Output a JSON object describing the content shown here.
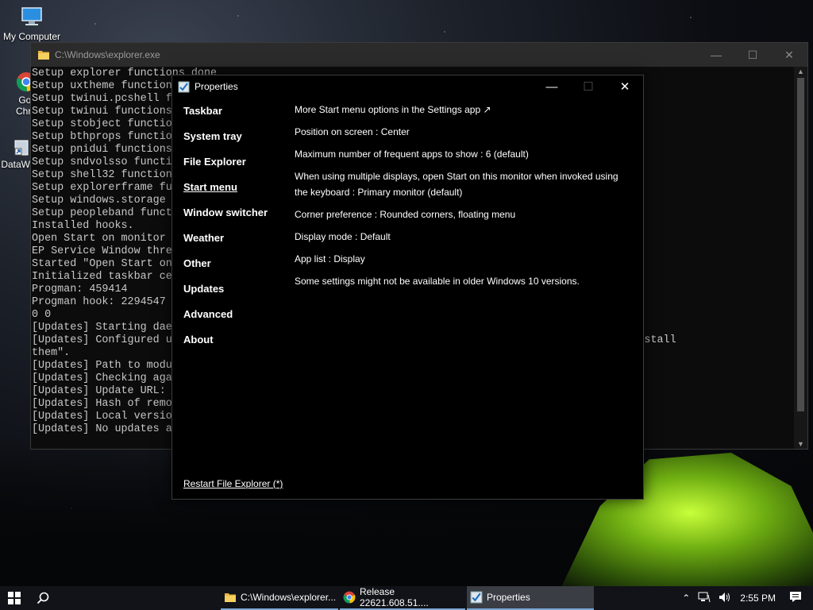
{
  "desktop": {
    "icons": [
      {
        "label": "My Computer",
        "icon": "computer-icon"
      },
      {
        "label": "Goo\nChro",
        "icon": "chrome-icon"
      },
      {
        "label": "DataW",
        "icon": "shortcut-icon"
      }
    ]
  },
  "console": {
    "title": "C:\\Windows\\explorer.exe",
    "lines": [
      "Setup explorer functions done",
      "Setup uxtheme function",
      "Setup twinui.pcshell f",
      "Setup twinui functions",
      "Setup stobject functio",
      "Setup bthprops functio",
      "Setup pnidui functions",
      "Setup sndvolsso functi",
      "Setup shell32 function",
      "Setup explorerframe fu",
      "Setup windows.storage",
      "Setup peopleband funct",
      "Installed hooks.",
      "Open Start on monitor",
      "EP Service Window thre",
      "Started \"Open Start on",
      "Initialized taskbar ce",
      "Progman: 459414",
      "Progman hook: 2294547",
      "0 0",
      "[Updates] Starting dae",
      "[Updates] Configured u                                                        to download and install",
      "them\".",
      "[Updates] Path to modu",
      "[Updates] Checking aga",
      "[Updates] Update URL:                                                         up.exe",
      "[Updates] Hash of remo",
      "[Updates] Local versio",
      "[Updates] No updates a"
    ]
  },
  "properties": {
    "title": "Properties",
    "nav": [
      {
        "label": "Taskbar",
        "active": false
      },
      {
        "label": "System tray",
        "active": false
      },
      {
        "label": "File Explorer",
        "active": false
      },
      {
        "label": "Start menu",
        "active": true
      },
      {
        "label": "Window switcher",
        "active": false
      },
      {
        "label": "Weather",
        "active": false
      },
      {
        "label": "Other",
        "active": false
      },
      {
        "label": "Updates",
        "active": false
      },
      {
        "label": "Advanced",
        "active": false
      },
      {
        "label": "About",
        "active": false
      }
    ],
    "settings": [
      "More Start menu options in the Settings app ↗",
      "Position on screen : Center",
      "Maximum number of frequent apps to show : 6 (default)",
      "When using multiple displays, open Start on this monitor when invoked using the keyboard : Primary monitor (default)",
      "Corner preference : Rounded corners, floating menu",
      "Display mode : Default",
      "App list : Display",
      "Some settings might not be available in older Windows 10 versions."
    ],
    "restart_link": "Restart File Explorer (*)"
  },
  "taskbar": {
    "tasks": [
      {
        "label": "C:\\Windows\\explorer...",
        "icon": "folder-icon",
        "active": false
      },
      {
        "label": "Release 22621.608.51....",
        "icon": "chrome-icon",
        "active": false
      },
      {
        "label": "Properties",
        "icon": "properties-icon",
        "active": true
      }
    ],
    "clock": "2:55 PM"
  }
}
